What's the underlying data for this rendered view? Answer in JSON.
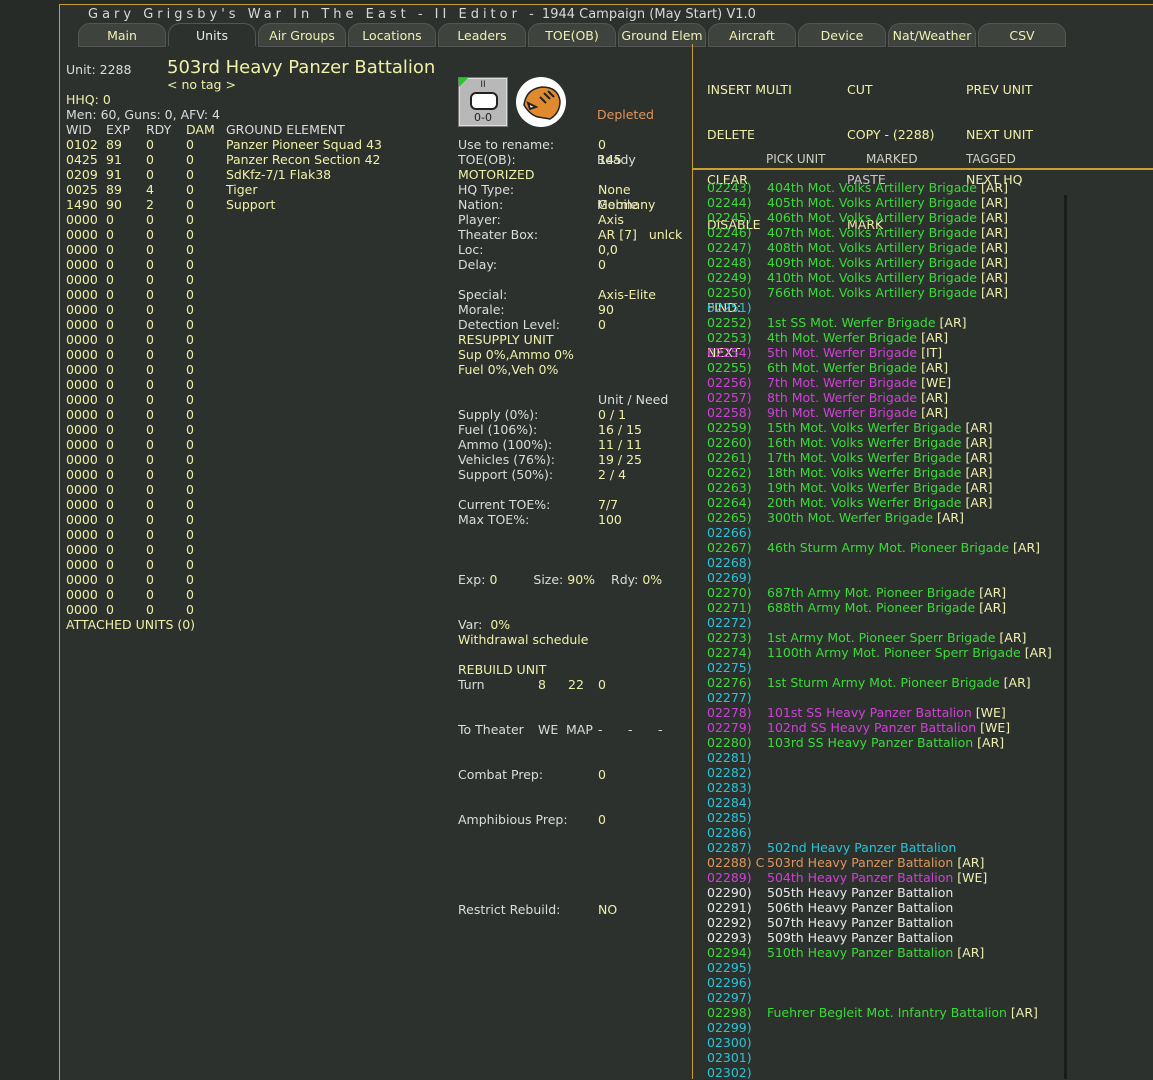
{
  "title": {
    "game": "Gary Grigsby's War In The East - II Editor -",
    "scenario": "1944 Campaign (May Start) V1.0"
  },
  "tabs": [
    "Main",
    "Units",
    "Air Groups",
    "Locations",
    "Leaders",
    "TOE(OB)",
    "Ground Elem",
    "Aircraft",
    "Device",
    "Nat/Weather",
    "CSV"
  ],
  "active_tab": "Units",
  "unit": {
    "id_label": "Unit: 2288",
    "name": "503rd Heavy Panzer Battalion",
    "tag": "< no tag >",
    "hhq": "HHQ: 0",
    "summary": "Men: 60, Guns: 0, AFV: 4",
    "counter_size": "II",
    "counter_value": "0-0",
    "status": [
      "Depleted",
      "Ready",
      "Mobile"
    ]
  },
  "elements": {
    "headers": [
      "WID",
      "EXP",
      "RDY",
      "DAM",
      "GROUND ELEMENT"
    ],
    "rows": [
      [
        "0102",
        "89",
        "0",
        "0",
        "Panzer Pioneer Squad 43"
      ],
      [
        "0425",
        "91",
        "0",
        "0",
        "Panzer Recon Section 42"
      ],
      [
        "0209",
        "91",
        "0",
        "0",
        "SdKfz-7/1 Flak38"
      ],
      [
        "0025",
        "89",
        "4",
        "0",
        "Tiger"
      ],
      [
        "1490",
        "90",
        "2",
        "0",
        "Support"
      ]
    ],
    "empty_row": [
      "0000",
      "0",
      "0",
      "0"
    ],
    "empty_count": 27,
    "attached": "ATTACHED UNITS (0)"
  },
  "details": [
    [
      "Use to rename:",
      "0"
    ],
    [
      "TOE(OB):",
      "145"
    ],
    [
      "MOTORIZED",
      ""
    ],
    [
      "HQ Type:",
      "None"
    ],
    [
      "Nation:",
      "Germany"
    ],
    [
      "Player:",
      "Axis"
    ],
    [
      "Theater Box:",
      "AR [7]   unlck"
    ],
    [
      "Loc:",
      "0,0"
    ],
    [
      "Delay:",
      "0"
    ],
    [
      "",
      ""
    ],
    [
      "Special:",
      "Axis-Elite"
    ],
    [
      "Morale:",
      "90"
    ],
    [
      "Detection Level:",
      "0"
    ],
    [
      "RESUPPLY UNIT",
      ""
    ],
    [
      "Sup 0%,Ammo 0%",
      ""
    ],
    [
      "Fuel 0%,Veh 0%",
      ""
    ],
    [
      "",
      ""
    ],
    [
      "",
      "Unit / Need"
    ],
    [
      "Supply (0%):",
      "0 / 1"
    ],
    [
      "Fuel (106%):",
      "16 / 15"
    ],
    [
      "Ammo (100%):",
      "11 / 11"
    ],
    [
      "Vehicles (76%):",
      "19 / 25"
    ],
    [
      "Support (50%):",
      "2 / 4"
    ],
    [
      "",
      ""
    ],
    [
      "Current TOE%:",
      "7/7"
    ],
    [
      "Max TOE%:",
      "100"
    ]
  ],
  "exp": {
    "exp_label": "Exp:",
    "exp": "0",
    "size_label": "Size:",
    "size": "90%",
    "rdy_label": "Rdy:",
    "rdy": "0%",
    "var_label": "Var:",
    "var": "0%",
    "rebuild": "REBUILD UNIT"
  },
  "withdrawal": {
    "title": "Withdrawal schedule",
    "turn_label": "Turn",
    "turn": [
      "8",
      "22",
      "0"
    ],
    "theater_label": "To Theater",
    "theater": [
      "WE",
      "MAP",
      "-",
      "-",
      "-"
    ],
    "combat_prep_label": "Combat Prep:",
    "combat_prep": "0",
    "amph_label": "Amphibious Prep:",
    "amph": "0",
    "restrict_label": "Restrict Rebuild:",
    "restrict": "NO"
  },
  "commands": {
    "col1": [
      "INSERT MULTI",
      "DELETE",
      "CLEAR",
      "DISABLE"
    ],
    "col2": [
      "CUT",
      "COPY - (2288)",
      "PASTE",
      "MARK"
    ],
    "col3": [
      "PREV UNIT",
      "NEXT UNIT",
      "NEXT HQ"
    ],
    "find": "FIND:",
    "next": "NEXT",
    "pick": "PICK UNIT",
    "marked": "MARKED",
    "tagged": "TAGGED"
  },
  "colors": {
    "green": "#3ada3a",
    "cyan": "#28c4d8",
    "magenta": "#d040d8",
    "orange": "#e0955a",
    "white": "#e8e8e8",
    "tag": "#f0f0b0"
  },
  "units": [
    [
      "02243)",
      "404th Mot. Volks Artillery Brigade",
      "[AR]",
      "green"
    ],
    [
      "02244)",
      "405th Mot. Volks Artillery Brigade",
      "[AR]",
      "green"
    ],
    [
      "02245)",
      "406th Mot. Volks Artillery Brigade",
      "[AR]",
      "green"
    ],
    [
      "02246)",
      "407th Mot. Volks Artillery Brigade",
      "[AR]",
      "green"
    ],
    [
      "02247)",
      "408th Mot. Volks Artillery Brigade",
      "[AR]",
      "green"
    ],
    [
      "02248)",
      "409th Mot. Volks Artillery Brigade",
      "[AR]",
      "green"
    ],
    [
      "02249)",
      "410th Mot. Volks Artillery Brigade",
      "[AR]",
      "green"
    ],
    [
      "02250)",
      "766th Mot. Volks Artillery Brigade",
      "[AR]",
      "green"
    ],
    [
      "02251)",
      "",
      "",
      "cyan"
    ],
    [
      "02252)",
      "1st SS Mot. Werfer Brigade",
      "[AR]",
      "green"
    ],
    [
      "02253)",
      "4th Mot. Werfer Brigade",
      "[AR]",
      "green"
    ],
    [
      "02254)",
      "5th Mot. Werfer Brigade",
      "[IT]",
      "magenta"
    ],
    [
      "02255)",
      "6th Mot. Werfer Brigade",
      "[AR]",
      "green"
    ],
    [
      "02256)",
      "7th Mot. Werfer Brigade",
      "[WE]",
      "magenta"
    ],
    [
      "02257)",
      "8th Mot. Werfer Brigade",
      "[AR]",
      "magenta"
    ],
    [
      "02258)",
      "9th Mot. Werfer Brigade",
      "[AR]",
      "magenta"
    ],
    [
      "02259)",
      "15th Mot. Volks Werfer Brigade",
      "[AR]",
      "green"
    ],
    [
      "02260)",
      "16th Mot. Volks Werfer Brigade",
      "[AR]",
      "green"
    ],
    [
      "02261)",
      "17th Mot. Volks Werfer Brigade",
      "[AR]",
      "green"
    ],
    [
      "02262)",
      "18th Mot. Volks Werfer Brigade",
      "[AR]",
      "green"
    ],
    [
      "02263)",
      "19th Mot. Volks Werfer Brigade",
      "[AR]",
      "green"
    ],
    [
      "02264)",
      "20th Mot. Volks Werfer Brigade",
      "[AR]",
      "green"
    ],
    [
      "02265)",
      "300th Mot. Werfer Brigade",
      "[AR]",
      "green"
    ],
    [
      "02266)",
      "",
      "",
      "cyan"
    ],
    [
      "02267)",
      "46th Sturm Army Mot. Pioneer Brigade",
      "[AR]",
      "green"
    ],
    [
      "02268)",
      "",
      "",
      "cyan"
    ],
    [
      "02269)",
      "",
      "",
      "cyan"
    ],
    [
      "02270)",
      "687th Army Mot. Pioneer Brigade",
      "[AR]",
      "green"
    ],
    [
      "02271)",
      "688th Army Mot. Pioneer Brigade",
      "[AR]",
      "green"
    ],
    [
      "02272)",
      "",
      "",
      "cyan"
    ],
    [
      "02273)",
      "1st Army Mot. Pioneer Sperr Brigade",
      "[AR]",
      "green"
    ],
    [
      "02274)",
      "1100th Army Mot. Pioneer Sperr Brigade",
      "[AR]",
      "green"
    ],
    [
      "02275)",
      "",
      "",
      "cyan"
    ],
    [
      "02276)",
      "1st Sturm Army Mot. Pioneer Brigade",
      "[AR]",
      "green"
    ],
    [
      "02277)",
      "",
      "",
      "cyan"
    ],
    [
      "02278)",
      "101st SS Heavy Panzer Battalion",
      "[WE]",
      "magenta"
    ],
    [
      "02279)",
      "102nd SS Heavy Panzer Battalion",
      "[WE]",
      "magenta"
    ],
    [
      "02280)",
      "103rd SS Heavy Panzer Battalion",
      "[AR]",
      "green"
    ],
    [
      "02281)",
      "",
      "",
      "cyan"
    ],
    [
      "02282)",
      "",
      "",
      "cyan"
    ],
    [
      "02283)",
      "",
      "",
      "cyan"
    ],
    [
      "02284)",
      "",
      "",
      "cyan"
    ],
    [
      "02285)",
      "",
      "",
      "cyan"
    ],
    [
      "02286)",
      "",
      "",
      "cyan"
    ],
    [
      "02287)",
      "502nd Heavy Panzer Battalion",
      "",
      "cyan"
    ],
    [
      "02288) C",
      "503rd Heavy Panzer Battalion",
      "[AR]",
      "orange"
    ],
    [
      "02289)",
      "504th Heavy Panzer Battalion",
      "[WE]",
      "magenta"
    ],
    [
      "02290)",
      "505th Heavy Panzer Battalion",
      "",
      "white"
    ],
    [
      "02291)",
      "506th Heavy Panzer Battalion",
      "",
      "white"
    ],
    [
      "02292)",
      "507th Heavy Panzer Battalion",
      "",
      "white"
    ],
    [
      "02293)",
      "509th Heavy Panzer Battalion",
      "",
      "white"
    ],
    [
      "02294)",
      "510th Heavy Panzer Battalion",
      "[AR]",
      "green"
    ],
    [
      "02295)",
      "",
      "",
      "cyan"
    ],
    [
      "02296)",
      "",
      "",
      "cyan"
    ],
    [
      "02297)",
      "",
      "",
      "cyan"
    ],
    [
      "02298)",
      "Fuehrer Begleit Mot. Infantry Battalion",
      "[AR]",
      "green"
    ],
    [
      "02299)",
      "",
      "",
      "cyan"
    ],
    [
      "02300)",
      "",
      "",
      "cyan"
    ],
    [
      "02301)",
      "",
      "",
      "cyan"
    ],
    [
      "02302)",
      "",
      "",
      "cyan"
    ]
  ]
}
